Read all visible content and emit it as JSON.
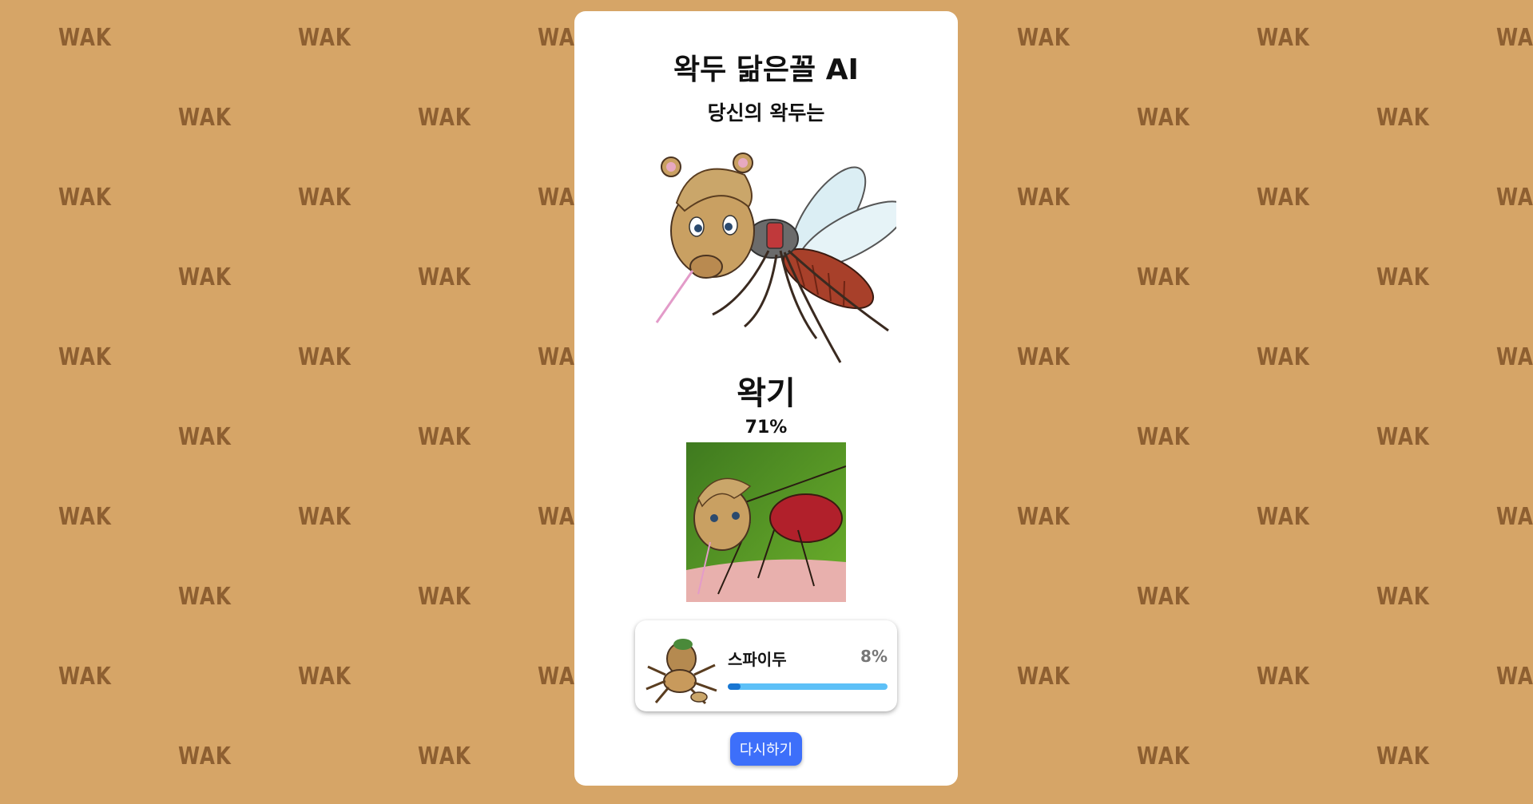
{
  "background": {
    "color": "#d6a567",
    "watermark_text": "WAK",
    "watermark_color": "#8d5f31"
  },
  "card": {
    "title": "왁두 닮은꼴 AI",
    "subtitle": "당신의 왁두는",
    "result": {
      "name": "왁기",
      "percent": "71%"
    },
    "ranking": [
      {
        "label": "스파이두",
        "percent_text": "8%",
        "value": 0.08
      }
    ],
    "retry_label": "다시하기",
    "colors": {
      "accent": "#3d6ffa",
      "bar_track": "#5dc0f7",
      "bar_fill": "#1976d2"
    }
  }
}
